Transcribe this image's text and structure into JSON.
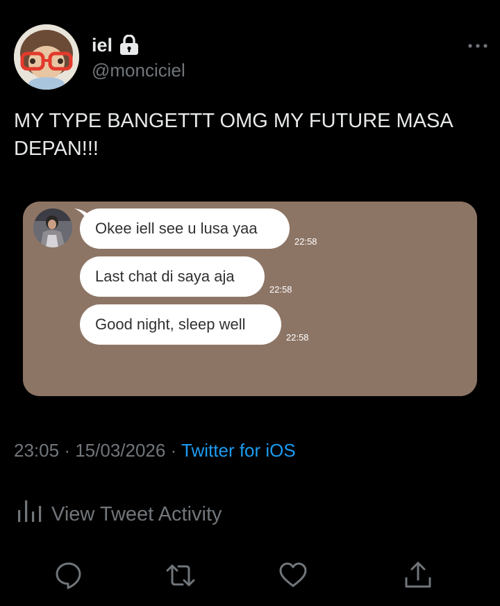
{
  "author": {
    "display_name": "iel",
    "handle": "@monciciel",
    "protected_icon": "lock-icon",
    "avatar_icon": "avatar-doll-with-red-glasses"
  },
  "tweet": {
    "text": "MY TYPE BANGETTT OMG MY FUTURE MASA DEPAN!!!"
  },
  "media": {
    "background_color": "#8d7566",
    "messages": [
      {
        "text": "Okee iell see u lusa yaa",
        "time": "22:58"
      },
      {
        "text": "Last chat di saya aja",
        "time": "22:58"
      },
      {
        "text": "Good night, sleep well",
        "time": "22:58"
      }
    ]
  },
  "meta": {
    "time": "23:05",
    "separator": "·",
    "date": "15/03/2026",
    "source": "Twitter for iOS"
  },
  "activity": {
    "label": "View Tweet Activity",
    "icon": "bar-chart-icon"
  },
  "actions": {
    "reply_icon": "reply-icon",
    "retweet_icon": "retweet-icon",
    "like_icon": "heart-icon",
    "share_icon": "share-icon"
  },
  "colors": {
    "background": "#000000",
    "text": "#e7e9ea",
    "secondary": "#71767b",
    "accent": "#1d9bf0"
  }
}
